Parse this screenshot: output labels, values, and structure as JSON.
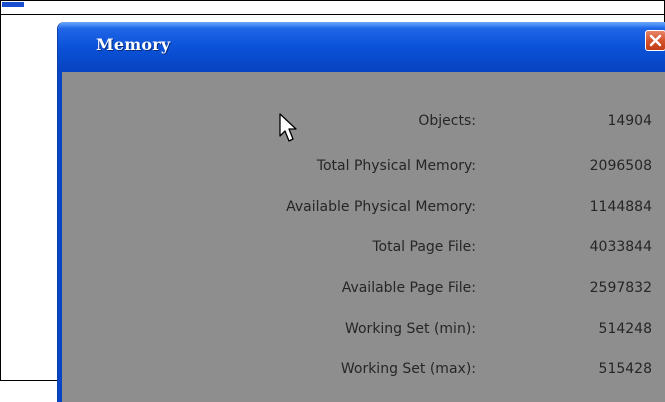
{
  "window": {
    "title": "Memory",
    "close_icon": "close-icon"
  },
  "stats": [
    {
      "label": "Objects:",
      "value": "14904"
    },
    {
      "label": "Total Physical Memory:",
      "value": "2096508"
    },
    {
      "label": "Available Physical Memory:",
      "value": "1144884"
    },
    {
      "label": "Total Page File:",
      "value": "4033844"
    },
    {
      "label": "Available Page File:",
      "value": "2597832"
    },
    {
      "label": "Working Set (min):",
      "value": "514248"
    },
    {
      "label": "Working Set (max):",
      "value": "515428"
    }
  ],
  "colors": {
    "titlebar": "#0a52d8",
    "content_background": "#8e8e8e",
    "close_button": "#d5542e",
    "text": "#262626"
  },
  "cursor_icon": "arrow-cursor-icon"
}
